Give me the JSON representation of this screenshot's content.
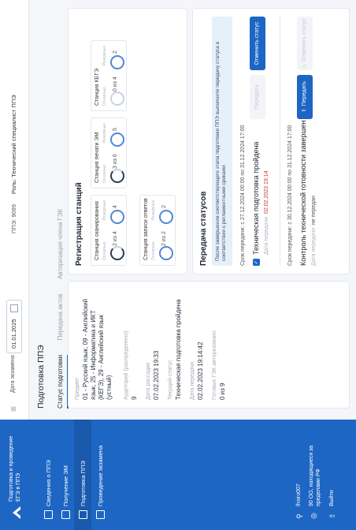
{
  "brand": {
    "line1": "Подготовка и проведение",
    "line2": "ЕГЭ в ППЭ"
  },
  "sidebar": {
    "items": [
      {
        "label": "Сведения о ППЭ"
      },
      {
        "label": "Получение ЭМ"
      },
      {
        "label": "Подготовка ППЭ"
      },
      {
        "label": "Проведение экзамена"
      }
    ],
    "user": "lhoiro007",
    "org": "90 ОО, находящиеся за пределами РФ",
    "logout": "Выйти"
  },
  "topbar": {
    "date_label": "Дата экзамена",
    "date_value": "01.01.2025",
    "ppe_label": "ППЭ: 9099",
    "role_label": "Роль: Технический специалист ППЭ"
  },
  "page": {
    "title": "Подготовка ППЭ",
    "tabs": [
      "Статус подготовки",
      "Передача актов",
      "Авторизация члена ГЭК"
    ]
  },
  "left": {
    "subject_k": "Предмет",
    "subject_v": "01 - Русский язык, 09 - Английский язык, 25 - Информатика и ИКТ (КЕГЭ), 29 - Английский язык (устный)",
    "rooms_k": "Аудиторий (распределено)",
    "rooms_v": "9",
    "date_k": "Дата рассадки",
    "date_v": "07.02.2023 19:33",
    "status_k": "Текущий статус",
    "status_v": "Техническая подготовка пройдена",
    "transfer_k": "Дата передачи",
    "transfer_v": "02.02.2023 19:14:42",
    "ready_k": "Готовых ГЭК авторизовано",
    "ready_v": "0 из 9"
  },
  "stations": {
    "title": "Регистрация станций",
    "items": [
      {
        "name": "Станция сканирования",
        "a": "Основных",
        "b": "Резервных",
        "l": "2 из 4",
        "r": "4"
      },
      {
        "name": "Станция печати ЭМ",
        "a": "Основных",
        "b": "Резервных",
        "l": "3 из 6",
        "r": "5"
      },
      {
        "name": "Станция КЕГЭ",
        "a": "Основных",
        "b": "Резервных",
        "l": "0 из 4",
        "r": "2"
      },
      {
        "name": "Станция записи ответов",
        "a": "Основных",
        "b": "Резервных",
        "l": "2 из 2",
        "r": "2"
      }
    ]
  },
  "transfer": {
    "title": "Передача статусов",
    "info": "После завершения соответствующего этапа подготовки ППЭ выполните передачу статуса в соответствии с регламентными сроками",
    "period1": "Срок передачи: с 27.12.2024 00:00 по 31.12.2024 17:00",
    "status1": "Техническая подготовка пройдена",
    "date1_k": "Дата передачи",
    "date1_v": "02.02.2023 19:14",
    "btn_transfer_disabled": "Передать",
    "btn_cancel": "Отменить статус",
    "period2": "Срок передачи: с 30.12.2024 00:00 по 31.12.2024 17:00",
    "status2": "Контроль технической готовности завершен",
    "date2_k": "Дата передачи",
    "date2_v": "не передан",
    "btn_transfer": "Передать",
    "btn_cancel_disabled": "Отменить статус"
  }
}
